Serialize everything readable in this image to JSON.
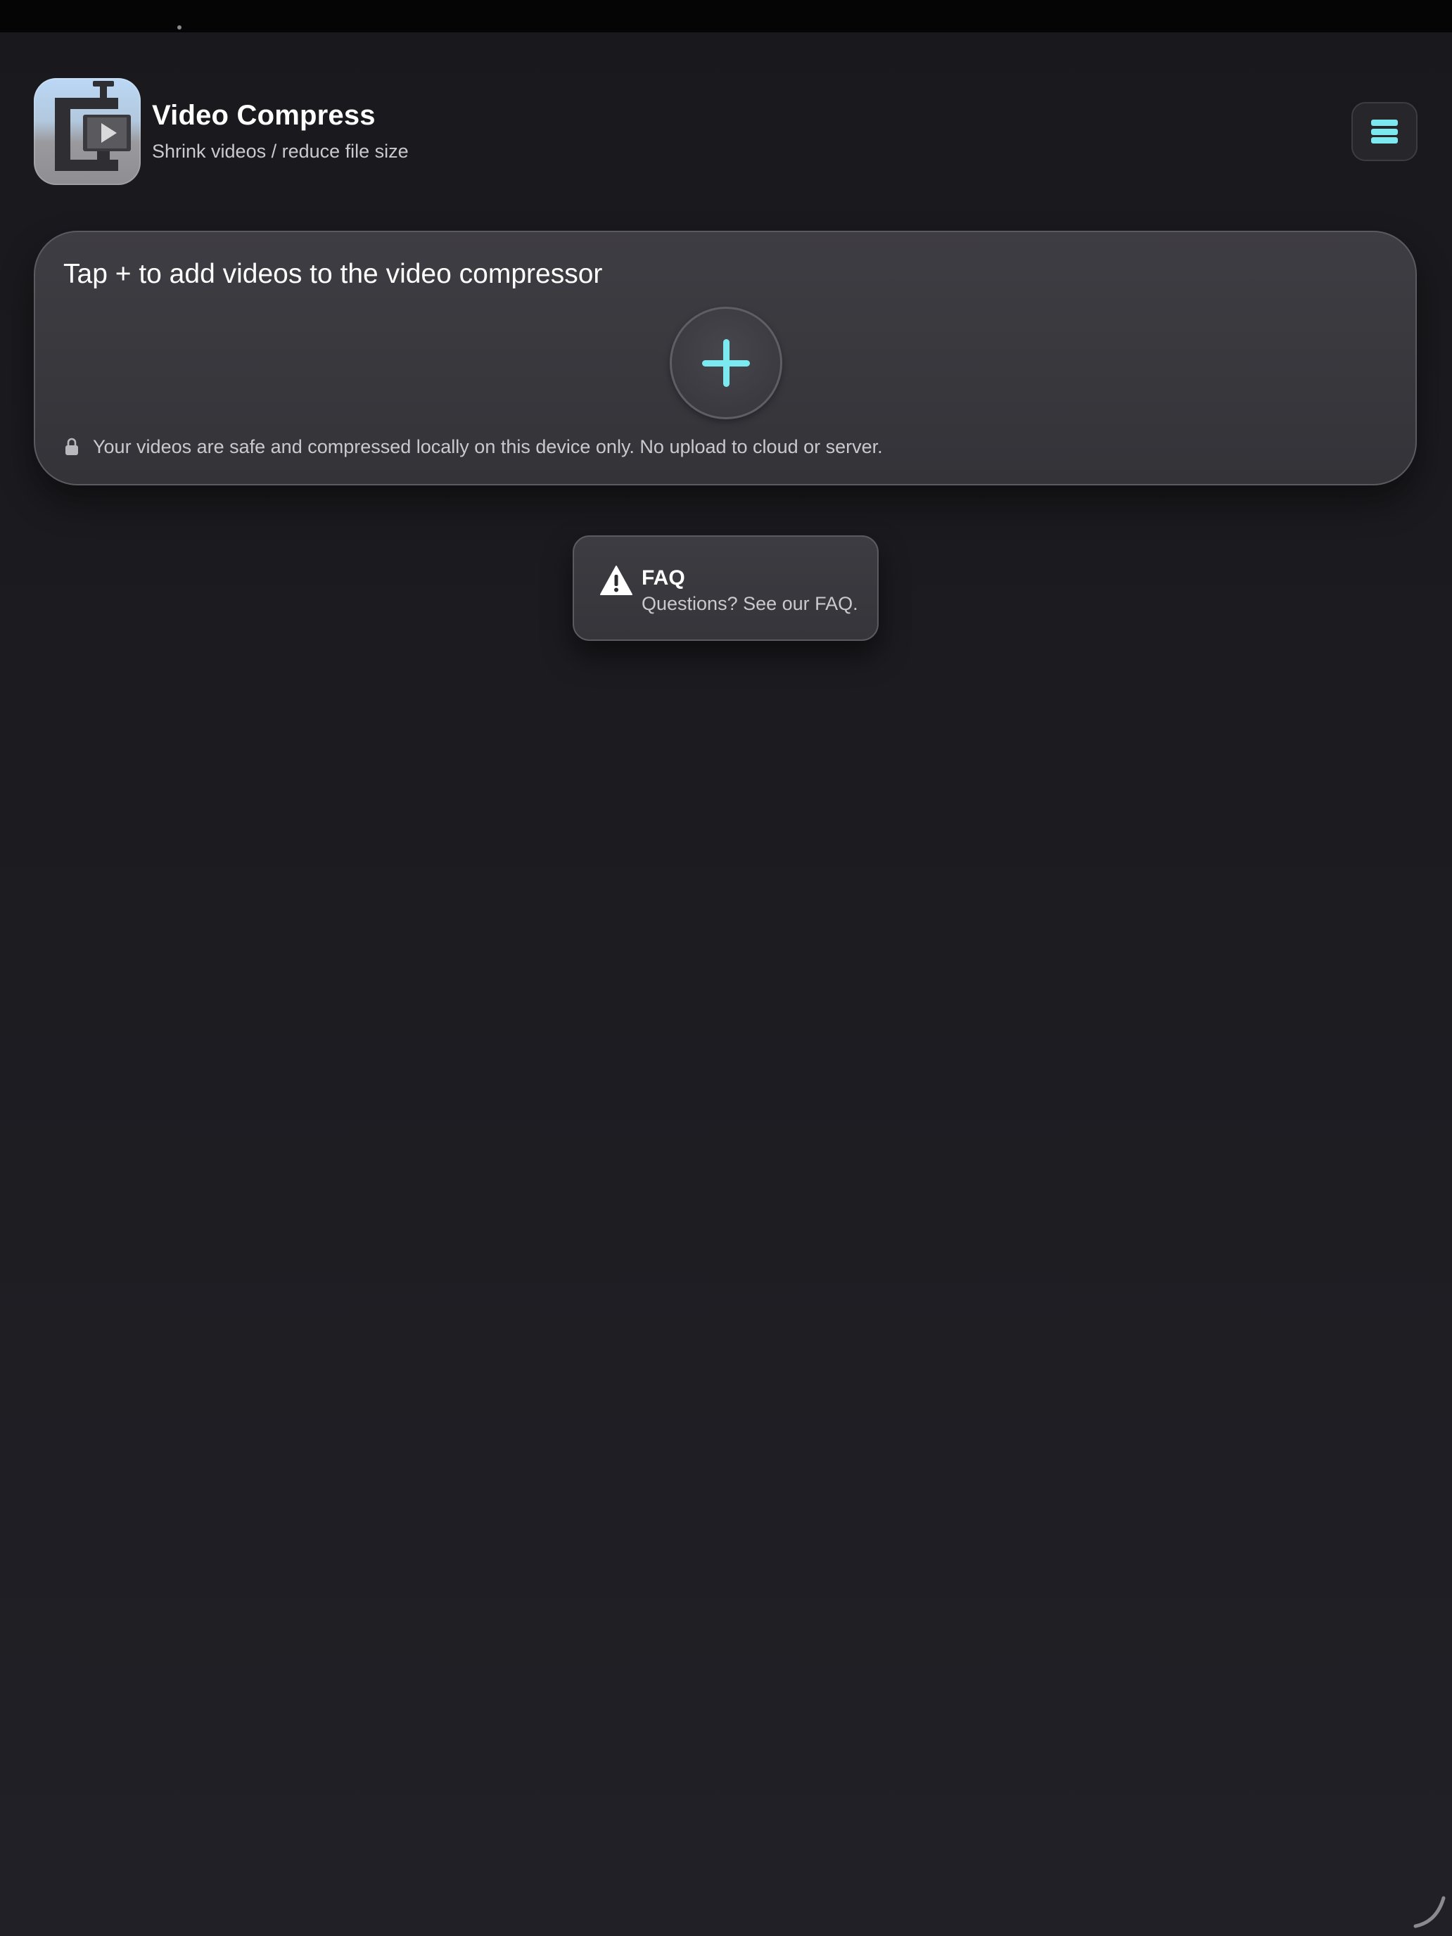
{
  "header": {
    "title": "Video Compress",
    "subtitle": "Shrink videos / reduce file size"
  },
  "add_card": {
    "title": "Tap + to add videos to the video compressor",
    "privacy_note": "Your videos are safe and compressed locally on this device only. No upload to cloud or server."
  },
  "faq": {
    "title": "FAQ",
    "subtitle": "Questions? See our FAQ."
  },
  "icons": {
    "app": "app-icon",
    "menu": "menu-icon",
    "add": "plus-icon",
    "lock": "lock-icon",
    "warning": "warning-icon",
    "resize": "resize-handle-icon"
  },
  "colors": {
    "accent": "#7ce8ef",
    "background": "#1c1c21",
    "card": "#38383d",
    "text_primary": "#ffffff",
    "text_secondary": "#c9c9ce"
  }
}
